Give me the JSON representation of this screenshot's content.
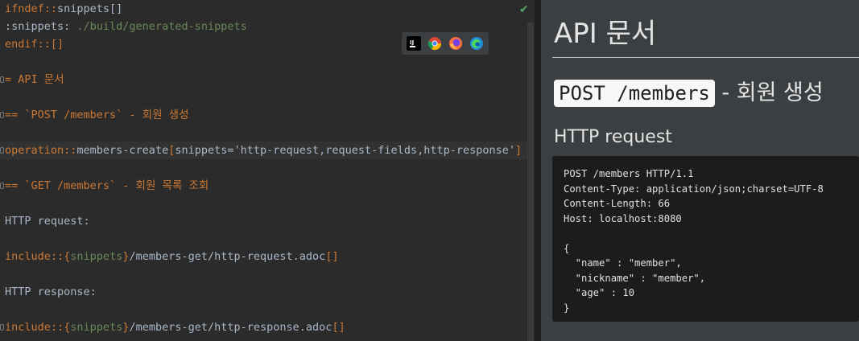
{
  "editor": {
    "line1": {
      "kw": "ifndef::",
      "rest": "snippets[]"
    },
    "line2": {
      "attr": ":snippets:",
      "val": " ./build/generated-snippets"
    },
    "line3": {
      "kw": "endif::",
      "rest": "[]"
    },
    "line4": "= API 문서",
    "line5": "== `POST /members` - 회원 생성",
    "line6": {
      "kw": "operation::",
      "name": "members-create",
      "open": "[",
      "args": "snippets='http-request,request-fields,http-response'",
      "close": "]"
    },
    "line7": "== `GET /members` - 회원 목록 조회",
    "line8": "HTTP request:",
    "line9": {
      "kw": "include::",
      "brace_open": "{",
      "attr": "snippets",
      "brace_close": "}",
      "path": "/members-get/http-request.adoc",
      "bracket": "[]"
    },
    "line10": "HTTP response:",
    "line11": {
      "kw": "include::",
      "brace_open": "{",
      "attr": "snippets",
      "brace_close": "}",
      "path": "/members-get/http-response.adoc",
      "bracket": "[]"
    },
    "check": "✔"
  },
  "browsers": [
    "intellij-icon",
    "chrome-icon",
    "firefox-icon",
    "edge-icon"
  ],
  "preview": {
    "title": "API 문서",
    "section_code": "POST /members",
    "section_rest": " - 회원 생성",
    "subheading": "HTTP request",
    "code": "POST /members HTTP/1.1\nContent-Type: application/json;charset=UTF-8\nContent-Length: 66\nHost: localhost:8080\n\n{\n  \"name\" : \"member\",\n  \"nickname\" : \"member\",\n  \"age\" : 10\n}"
  }
}
